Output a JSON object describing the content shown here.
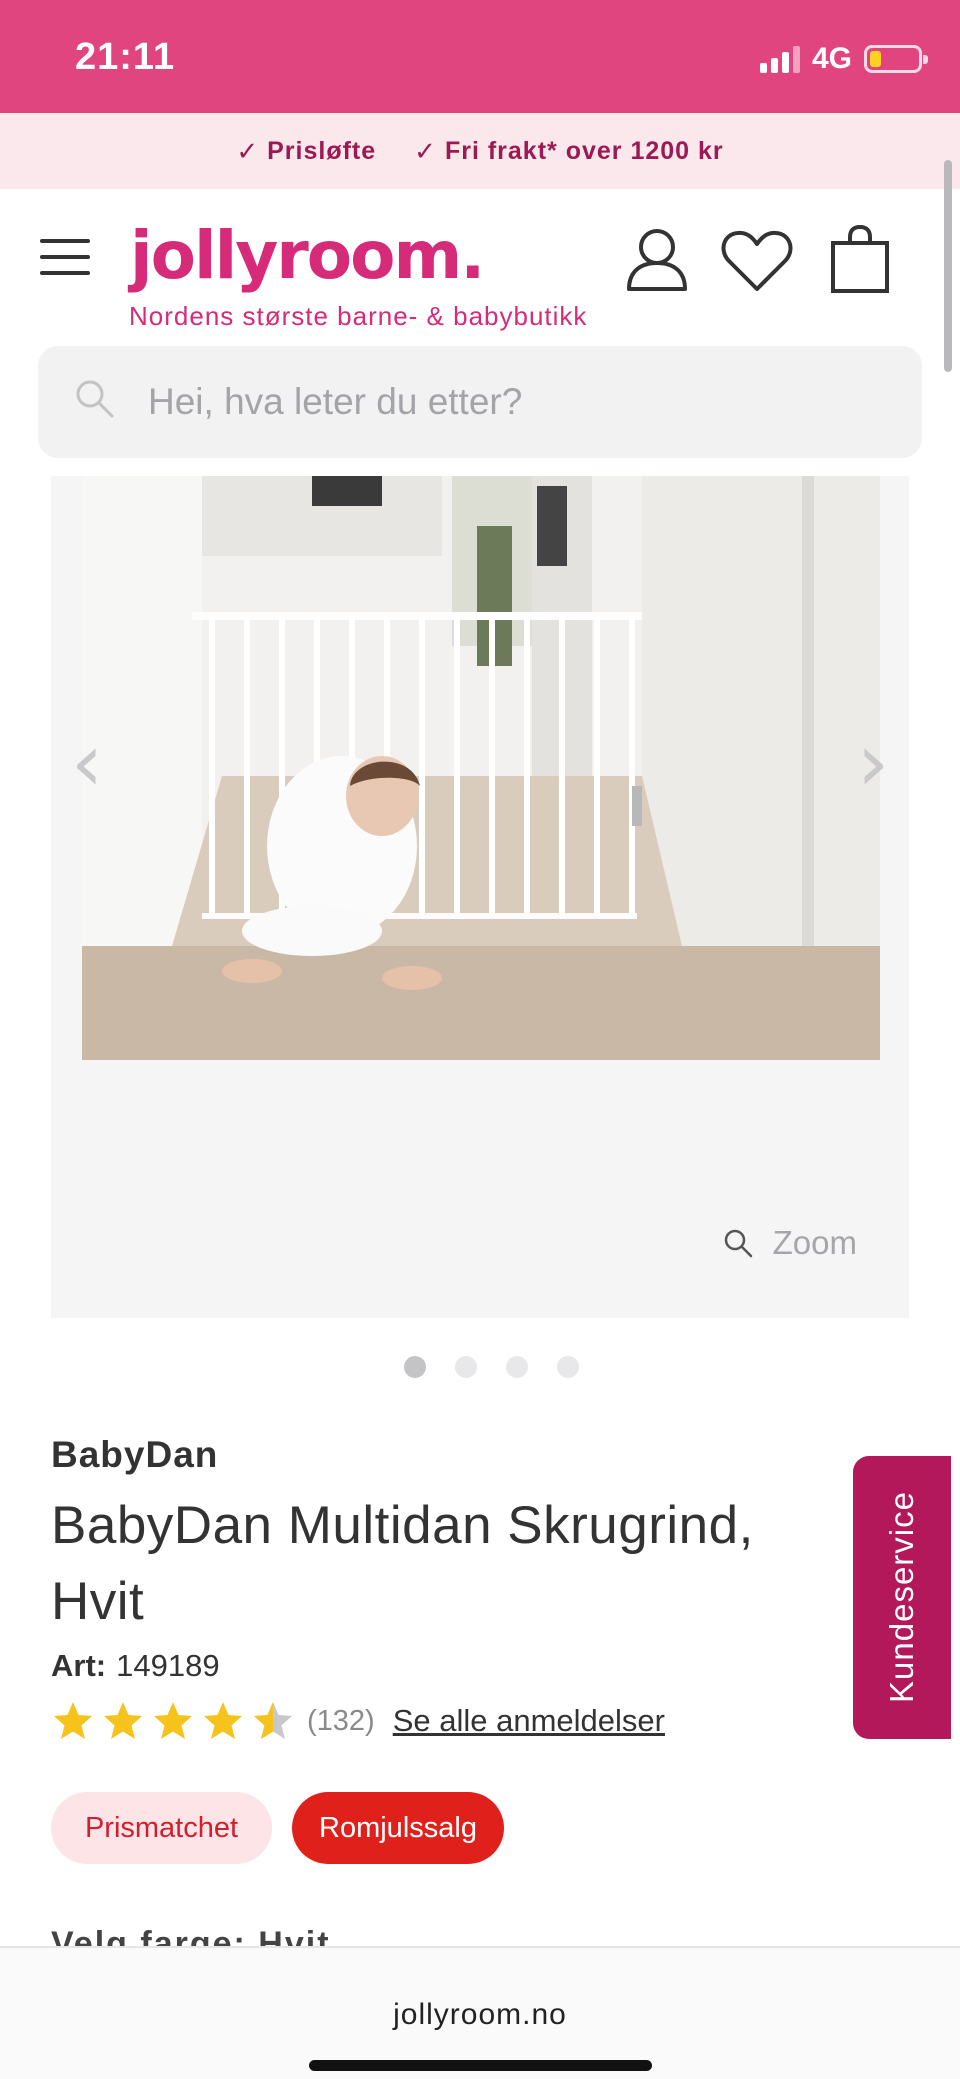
{
  "status_bar": {
    "time": "21:11",
    "network": "4G",
    "battery_color": "#ffd21f"
  },
  "promo": {
    "items": [
      "Prisløfte",
      "Fri frakt* over 1200 kr"
    ]
  },
  "header": {
    "logo": "jollyroom.",
    "tagline": "Nordens største barne- & babybutikk",
    "icons": [
      "menu-icon",
      "account-icon",
      "heart-icon",
      "cart-icon"
    ]
  },
  "search": {
    "placeholder": "Hei, hva leter du etter?"
  },
  "gallery": {
    "zoom_label": "Zoom",
    "image_count": 4,
    "active_index": 0
  },
  "product": {
    "brand": "BabyDan",
    "title": "BabyDan Multidan Skrugrind, Hvit",
    "art_label": "Art:",
    "art_number": "149189",
    "rating": 4.5,
    "rating_count": "(132)",
    "reviews_link": "Se alle anmeldelser",
    "badges": [
      "Prismatchet",
      "Romjulssalg"
    ],
    "next_heading_partial": "Velg farge: Hvit"
  },
  "customer_service": {
    "label": "Kundeservice"
  },
  "browser": {
    "url": "jollyroom.no"
  },
  "colors": {
    "brand_pink": "#d62b79",
    "status_pink": "#e0457f",
    "sale_red": "#e0211b",
    "service_purple": "#b3195a"
  }
}
